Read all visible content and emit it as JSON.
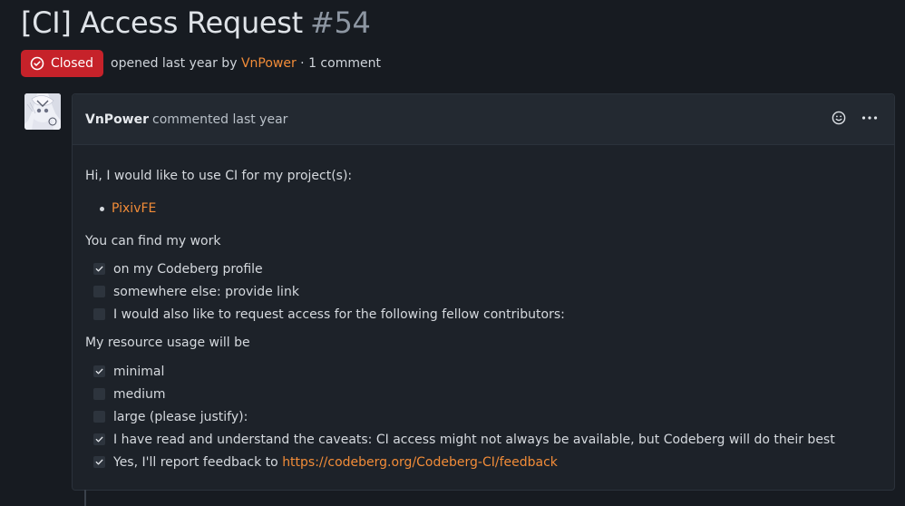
{
  "issue": {
    "title": "[CI] Access Request",
    "number": "#54",
    "state": "Closed",
    "meta_prefix": "opened last year by",
    "author": "VnPower",
    "meta_suffix": "· 1 comment"
  },
  "colors": {
    "closed": "#c6222a",
    "link": "#f28c38",
    "background": "#171b21"
  },
  "comment": {
    "author": "VnPower",
    "action": "commented last year",
    "icons": [
      "reaction-icon",
      "more-options-icon"
    ],
    "intro": "Hi, I would like to use CI for my project(s):",
    "projects": [
      "PixivFE"
    ],
    "find_heading": "You can find my work",
    "find_options": [
      {
        "label": "on my Codeberg profile",
        "checked": true
      },
      {
        "label": "somewhere else: provide link",
        "checked": false
      },
      {
        "label": "I would also like to request access for the following fellow contributors:",
        "checked": false
      }
    ],
    "usage_heading": "My resource usage will be",
    "usage_options": [
      {
        "label": "minimal",
        "checked": true
      },
      {
        "label": "medium",
        "checked": false
      },
      {
        "label": "large (please justify):",
        "checked": false
      },
      {
        "label": "I have read and understand the caveats: CI access might not always be available, but Codeberg will do their best",
        "checked": true
      }
    ],
    "feedback_prefix": "Yes, I'll report feedback to",
    "feedback_link": "https://codeberg.org/Codeberg-CI/feedback",
    "feedback_checked": true
  }
}
